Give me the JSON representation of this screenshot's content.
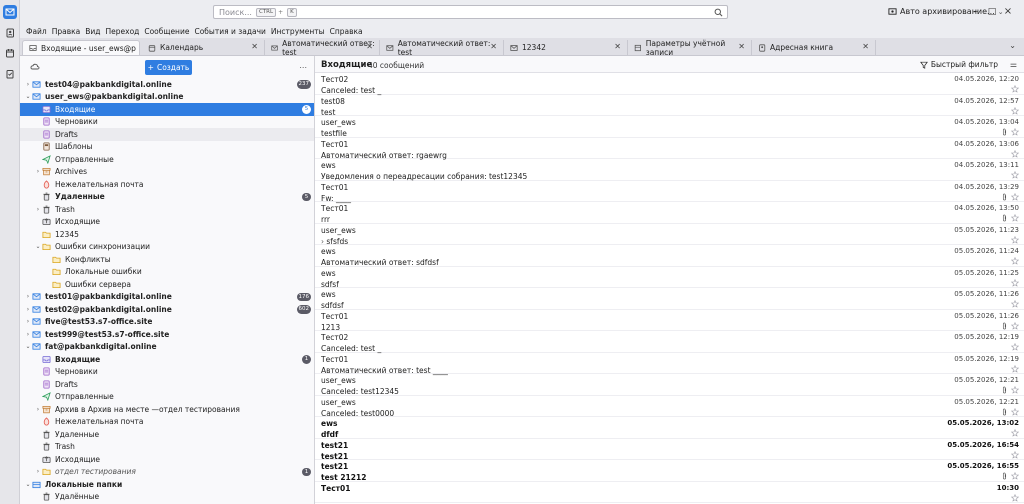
{
  "search": {
    "placeholder": "Поиск...",
    "kbd1": "CTRL",
    "plus": "+",
    "kbd2": "K"
  },
  "profile": {
    "label": "Авто архивирование..."
  },
  "window": {
    "minimize": "–",
    "maximize": "□",
    "close": "×"
  },
  "menu": [
    "Файл",
    "Правка",
    "Вид",
    "Переход",
    "Сообщение",
    "События и задачи",
    "Инструменты",
    "Справка"
  ],
  "tabs": [
    {
      "label": "Входящие - user_ews@pakbankdigital.online",
      "icon": "inbox-icon",
      "active": true
    },
    {
      "label": "Календарь",
      "icon": "calendar-icon"
    },
    {
      "label": "Автоматический ответ: test",
      "icon": "mail-icon"
    },
    {
      "label": "Автоматический ответ: test",
      "icon": "mail-icon"
    },
    {
      "label": "12342",
      "icon": "mail-icon"
    },
    {
      "label": "Параметры учётной записи",
      "icon": "settings-icon"
    },
    {
      "label": "Адресная книга",
      "icon": "address-book-icon"
    }
  ],
  "folder_pane": {
    "new_label": "Создать",
    "more": "...",
    "rows": [
      {
        "label": "test04@pakbankdigital.online",
        "kind": "account",
        "twisty": "›",
        "badge": "237"
      },
      {
        "label": "user_ews@pakbankdigital.online",
        "kind": "account",
        "twisty": "⌄"
      },
      {
        "label": "Входящие",
        "kind": "inbox",
        "level": 1,
        "badge": "5",
        "selected": true
      },
      {
        "label": "Черновики",
        "kind": "drafts",
        "level": 1
      },
      {
        "label": "Drafts",
        "kind": "drafts",
        "level": 1,
        "hover": true
      },
      {
        "label": "Шаблоны",
        "kind": "templates",
        "level": 1
      },
      {
        "label": "Отправленные",
        "kind": "sent",
        "level": 1
      },
      {
        "label": "Archives",
        "kind": "archive",
        "level": 1,
        "twisty": "›"
      },
      {
        "label": "Нежелательная почта",
        "kind": "junk",
        "level": 1
      },
      {
        "label": "Удаленные",
        "kind": "trash",
        "level": 1,
        "bold": true,
        "badge": "5"
      },
      {
        "label": "Trash",
        "kind": "trash",
        "level": 1,
        "twisty": "›"
      },
      {
        "label": "Исходящие",
        "kind": "outbox",
        "level": 1
      },
      {
        "label": "12345",
        "kind": "folder",
        "level": 1
      },
      {
        "label": "Ошибки синхронизации",
        "kind": "folder",
        "level": 1,
        "twisty": "⌄"
      },
      {
        "label": "Конфликты",
        "kind": "folder",
        "level": 2
      },
      {
        "label": "Локальные ошибки",
        "kind": "folder",
        "level": 2
      },
      {
        "label": "Ошибки сервера",
        "kind": "folder",
        "level": 2
      },
      {
        "label": "test01@pakbankdigital.online",
        "kind": "account",
        "twisty": "›",
        "badge": "176"
      },
      {
        "label": "test02@pakbankdigital.online",
        "kind": "account",
        "twisty": "›",
        "badge": "602"
      },
      {
        "label": "five@test53.s7-office.site",
        "kind": "account",
        "twisty": "›"
      },
      {
        "label": "test999@test53.s7-office.site",
        "kind": "account",
        "twisty": "›"
      },
      {
        "label": "fat@pakbankdigital.online",
        "kind": "account",
        "twisty": "⌄"
      },
      {
        "label": "Входящие",
        "kind": "inbox",
        "level": 1,
        "bold": true,
        "badge": "1"
      },
      {
        "label": "Черновики",
        "kind": "drafts",
        "level": 1
      },
      {
        "label": "Drafts",
        "kind": "drafts",
        "level": 1
      },
      {
        "label": "Отправленные",
        "kind": "sent",
        "level": 1
      },
      {
        "label": "Архив в Архив на месте —отдел тестирования",
        "kind": "archive",
        "level": 1,
        "twisty": "›"
      },
      {
        "label": "Нежелательная почта",
        "kind": "junk",
        "level": 1
      },
      {
        "label": "Удаленные",
        "kind": "trash",
        "level": 1
      },
      {
        "label": "Trash",
        "kind": "trash",
        "level": 1
      },
      {
        "label": "Исходящие",
        "kind": "outbox",
        "level": 1
      },
      {
        "label": "отдел тестирования",
        "kind": "folder",
        "level": 1,
        "twisty": "›",
        "italic": true,
        "badge": "1"
      },
      {
        "label": "Локальные папки",
        "kind": "local",
        "twisty": "⌄"
      },
      {
        "label": "Удалённые",
        "kind": "trash",
        "level": 1
      }
    ]
  },
  "message_list": {
    "title": "Входящие",
    "count": "40 сообщений",
    "quick_filter": "Быстрый фильтр",
    "messages": [
      {
        "from": "Тест02",
        "date": "04.05.2026, 12:20",
        "subject": "Canceled: test _"
      },
      {
        "from": "test08",
        "date": "04.05.2026, 12:57",
        "subject": "test"
      },
      {
        "from": "user_ews",
        "date": "04.05.2026, 13:04",
        "subject": "testfile",
        "attachment": true
      },
      {
        "from": "Тест01",
        "date": "04.05.2026, 13:06",
        "subject": "Автоматический ответ: rgaewrg"
      },
      {
        "from": "ews",
        "date": "04.05.2026, 13:11",
        "subject": "Уведомления о переадресации собрания: test12345"
      },
      {
        "from": "Тест01",
        "date": "04.05.2026, 13:29",
        "subject": "Fw: ____",
        "attachment": true
      },
      {
        "from": "Тест01",
        "date": "04.05.2026, 13:50",
        "subject": "rrr",
        "attachment": true
      },
      {
        "from": "user_ews",
        "date": "05.05.2026, 11:23",
        "subject": "sfsfds",
        "thread": true
      },
      {
        "from": "ews",
        "date": "05.05.2026, 11:24",
        "subject": "Автоматический ответ: sdfdsf"
      },
      {
        "from": "ews",
        "date": "05.05.2026, 11:25",
        "subject": "sdfsf"
      },
      {
        "from": "ews",
        "date": "05.05.2026, 11:26",
        "subject": "sdfdsf"
      },
      {
        "from": "Тест01",
        "date": "05.05.2026, 11:26",
        "subject": "1213",
        "attachment": true
      },
      {
        "from": "Тест02",
        "date": "05.05.2026, 12:19",
        "subject": "Canceled: test _"
      },
      {
        "from": "Тест01",
        "date": "05.05.2026, 12:19",
        "subject": "Автоматический ответ: test ____"
      },
      {
        "from": "user_ews",
        "date": "05.05.2026, 12:21",
        "subject": "Canceled: test12345",
        "attachment": true
      },
      {
        "from": "user_ews",
        "date": "05.05.2026, 12:21",
        "subject": "Canceled: test0000",
        "attachment": true
      },
      {
        "from": "ews",
        "date": "05.05.2026, 13:02",
        "subject": "dfdf",
        "unread": true
      },
      {
        "from": "test21",
        "date": "05.05.2026, 16:54",
        "subject": "test21",
        "unread": true
      },
      {
        "from": "test21",
        "date": "05.05.2026, 16:55",
        "subject": "test 21212",
        "unread": true,
        "attachment": true
      },
      {
        "from": "Тест01",
        "date": "10:30",
        "subject": "",
        "unread": true
      }
    ]
  },
  "colors": {
    "accent": "#2f7de1",
    "badge": "#5b5b66",
    "pane": "#f9f9fb"
  }
}
